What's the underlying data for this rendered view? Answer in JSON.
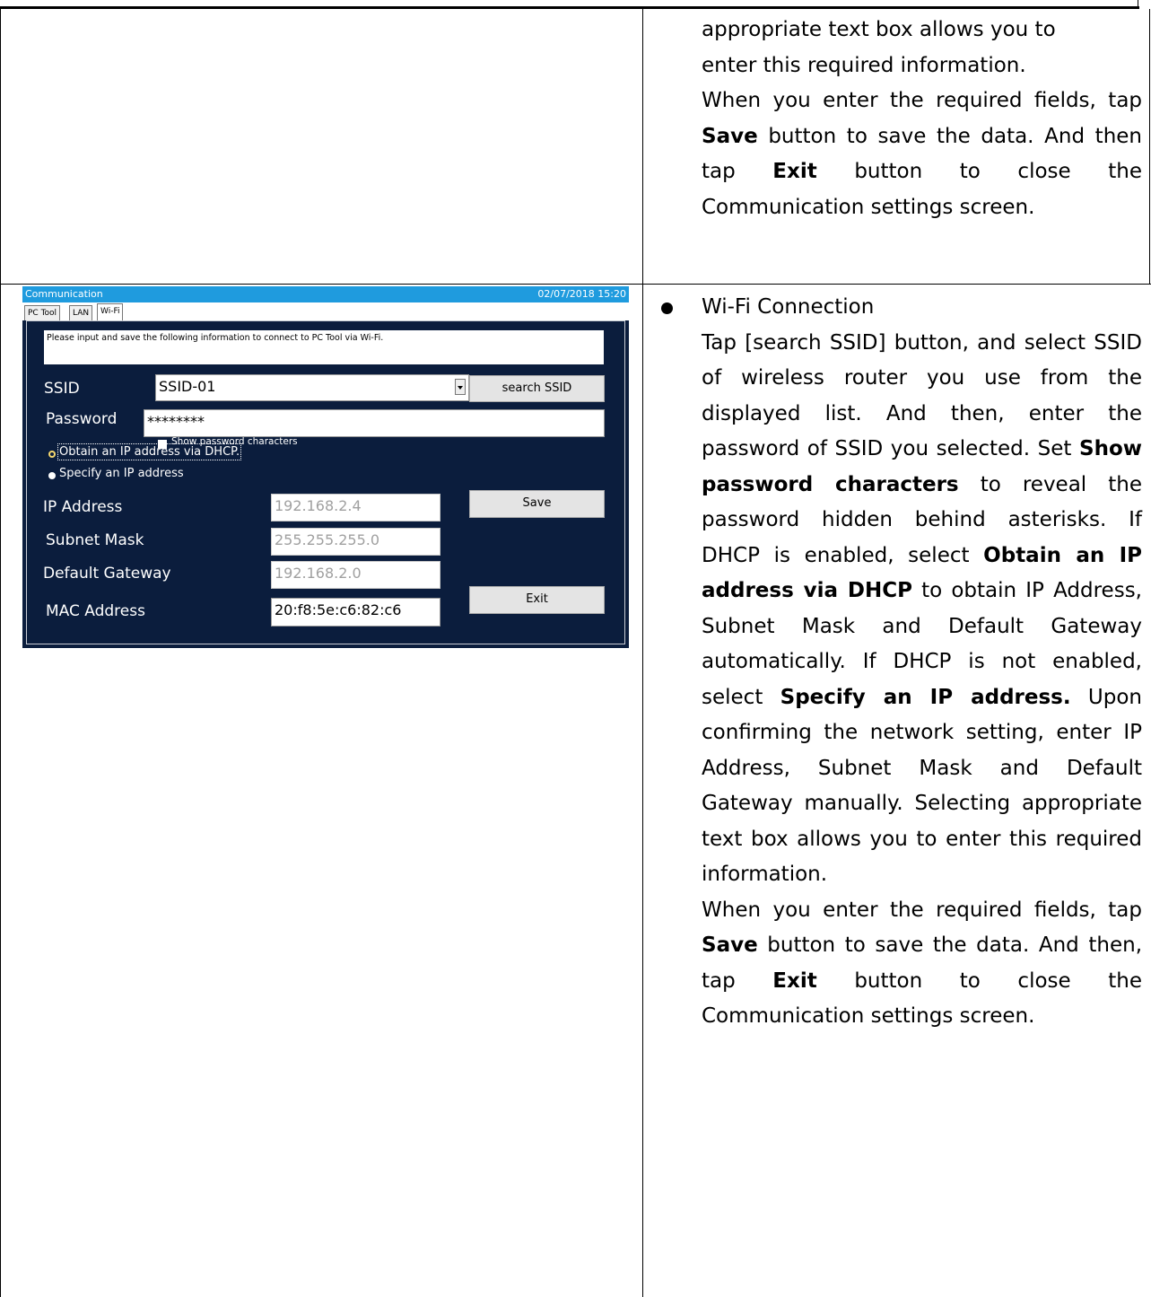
{
  "top_cell": {
    "lines": [
      "appropriate text box allows you to",
      "enter this required information."
    ],
    "p2": [
      "When you enter the required fields,",
      "tap ",
      "Save",
      " button to save the data.",
      "And then tap ",
      "Exit",
      " button to close the",
      "Communication settings screen."
    ]
  },
  "screen": {
    "title": "Communication",
    "datetime": "02/07/2018 15:20",
    "tabs": [
      "PC Tool",
      "LAN",
      "Wi-Fi"
    ],
    "message": "Please input and save the following information to connect to PC Tool via Wi-Fi.",
    "ssid_label": "SSID",
    "ssid_value": "SSID-01",
    "search_ssid": "search SSID",
    "password_label": "Password",
    "password_value": "********",
    "show_password": "Show password characters",
    "radio_dhcp": "Obtain an IP address via DHCP.",
    "radio_specify": "Specify an IP address",
    "ip_label": "IP Address",
    "ip_value": "192.168.2.4",
    "subnet_label": "Subnet Mask",
    "subnet_value": "255.255.255.0",
    "gateway_label": "Default Gateway",
    "gateway_value": "192.168.2.0",
    "mac_label": "MAC Address",
    "mac_value": "20:f8:5e:c6:82:c6",
    "save": "Save",
    "exit": "Exit"
  },
  "wifi_cell": {
    "heading": "Wi-Fi Connection",
    "t1": "Tap [search SSID] button, and select SSID of wireless router you use from the displayed list. And then, enter the password of SSID you selected. Set ",
    "b1": "Show password characters",
    "t2": " to reveal the password hidden behind asterisks. If DHCP is enabled, select ",
    "b2": "Obtain an IP address via DHCP",
    "t3": " to obtain IP Address, Subnet Mask and Default Gateway automatically. If DHCP is not enabled, select ",
    "b3": "Specify an IP address.",
    "t4": " Upon confirming the network setting, enter IP Address, Subnet Mask and Default Gateway manually. Selecting appropriate text box allows you to enter this required information.",
    "p2a": "When you enter the required fields, tap ",
    "p2b": "Save",
    "p2c": " button to save the data. And then, tap ",
    "p2d": "Exit",
    "p2e": " button to close the Communication settings screen."
  }
}
